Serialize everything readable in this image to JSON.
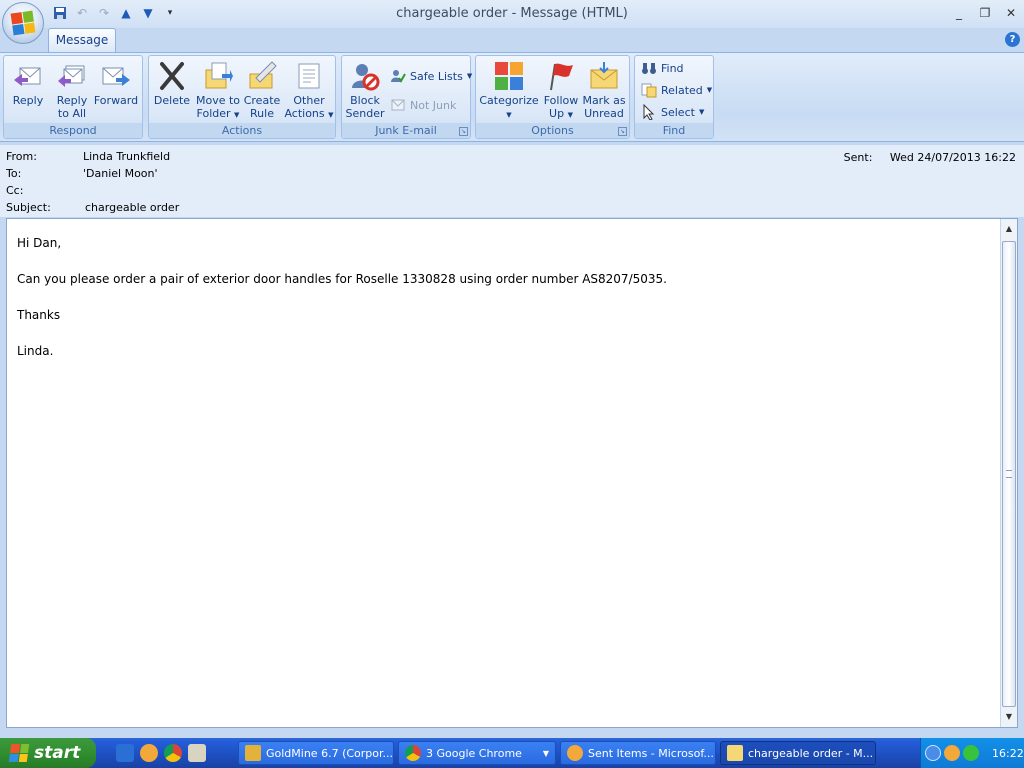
{
  "window": {
    "title": "chargeable order  - Message (HTML)",
    "minimize": "_",
    "restore": "❐",
    "close": "✕"
  },
  "tabs": [
    "Message"
  ],
  "ribbon": {
    "respond": {
      "label": "Respond",
      "reply": "Reply",
      "reply_all_1": "Reply",
      "reply_all_2": "to All",
      "forward": "Forward"
    },
    "actions": {
      "label": "Actions",
      "delete": "Delete",
      "move_1": "Move to",
      "move_2": "Folder",
      "create_1": "Create",
      "create_2": "Rule",
      "other_1": "Other",
      "other_2": "Actions"
    },
    "junk": {
      "label": "Junk E-mail",
      "block_1": "Block",
      "block_2": "Sender",
      "safe_lists": "Safe Lists",
      "not_junk": "Not Junk"
    },
    "options": {
      "label": "Options",
      "categorize": "Categorize",
      "follow_1": "Follow",
      "follow_2": "Up",
      "mark_1": "Mark as",
      "mark_2": "Unread"
    },
    "find": {
      "label": "Find",
      "find": "Find",
      "related": "Related",
      "select": "Select"
    }
  },
  "header": {
    "from_label": "From:",
    "from": "Linda Trunkfield",
    "to_label": "To:",
    "to": "'Daniel Moon'",
    "cc_label": "Cc:",
    "cc": "",
    "subject_label": "Subject:",
    "subject": "chargeable order",
    "sent_label": "Sent:",
    "sent": "Wed 24/07/2013 16:22"
  },
  "message_body": [
    "Hi Dan,",
    "Can you please order a pair of exterior door handles for Roselle 1330828 using order number AS8207/5035.",
    "Thanks",
    "Linda."
  ],
  "taskbar": {
    "start": "start",
    "tasks": [
      "GoldMine 6.7 (Corpor...",
      "3 Google Chrome",
      "Sent Items - Microsof...",
      "chargeable order  - M..."
    ],
    "clock": "16:22"
  },
  "colors": {
    "ribbon_text": "#15428b",
    "taskbar_blue": "#245edb",
    "start_green": "#2e8b2e"
  }
}
